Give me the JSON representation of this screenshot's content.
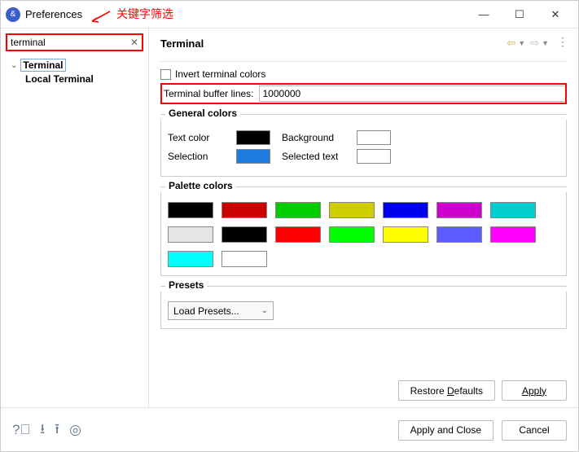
{
  "window": {
    "title": "Preferences",
    "annotation": "关键字筛选"
  },
  "sidebar": {
    "search_value": "terminal",
    "tree": {
      "root": "Terminal",
      "child": "Local Terminal"
    }
  },
  "content": {
    "title": "Terminal",
    "invert_label": "Invert terminal colors",
    "buffer_label": "Terminal buffer lines:",
    "buffer_value": "1000000",
    "general": {
      "title": "General colors",
      "text_color_label": "Text color",
      "background_label": "Background",
      "selection_label": "Selection",
      "selected_text_label": "Selected text",
      "text_color": "#000000",
      "background": "#ffffff",
      "selection": "#1e7be0",
      "selected_text": "#ffffff"
    },
    "palette": {
      "title": "Palette colors",
      "colors": [
        "#000000",
        "#cd0000",
        "#00cd00",
        "#cdcd00",
        "#0000ee",
        "#cd00cd",
        "#00cdcd",
        "#e5e5e5",
        "#000000",
        "#ff0000",
        "#00ff00",
        "#ffff00",
        "#5c5cff",
        "#ff00ff",
        "#00ffff",
        "#ffffff"
      ]
    },
    "presets": {
      "title": "Presets",
      "button_label": "Load Presets..."
    },
    "restore_button": "Restore Defaults",
    "apply_button": "Apply"
  },
  "footer": {
    "apply_close": "Apply and Close",
    "cancel": "Cancel"
  }
}
